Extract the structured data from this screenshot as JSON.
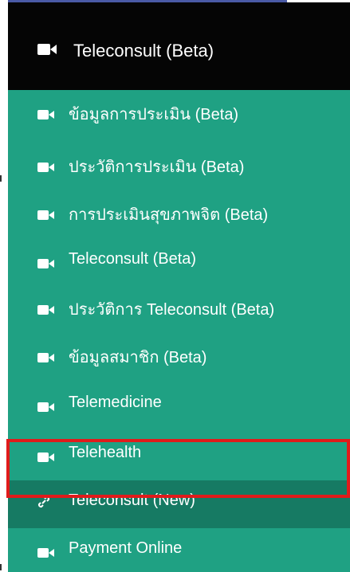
{
  "header": {
    "title": "Teleconsult (Beta)",
    "icon": "video-camera-icon"
  },
  "menu": {
    "items": [
      {
        "label": "ข้อมูลการประเมิน (Beta)",
        "icon": "video-camera-icon"
      },
      {
        "label": "ประวัติการประเมิน (Beta)",
        "icon": "video-camera-icon"
      },
      {
        "label": "การประเมินสุขภาพจิต (Beta)",
        "icon": "video-camera-icon"
      },
      {
        "label": "Teleconsult (Beta)",
        "icon": "video-camera-icon"
      },
      {
        "label": "ประวัติการ Teleconsult (Beta)",
        "icon": "video-camera-icon"
      },
      {
        "label": "ข้อมูลสมาชิก (Beta)",
        "icon": "video-camera-icon"
      },
      {
        "label": "Telemedicine",
        "icon": "video-camera-icon"
      },
      {
        "label": "Telehealth",
        "icon": "video-camera-icon"
      },
      {
        "label": "Teleconsult (New)",
        "icon": "link-icon"
      },
      {
        "label": "Payment Online",
        "icon": "video-camera-icon"
      }
    ]
  },
  "colors": {
    "menu_background": "#1fa183",
    "header_background": "#050505",
    "selected_background": "#167a63",
    "highlight_border": "#e01b1b"
  }
}
